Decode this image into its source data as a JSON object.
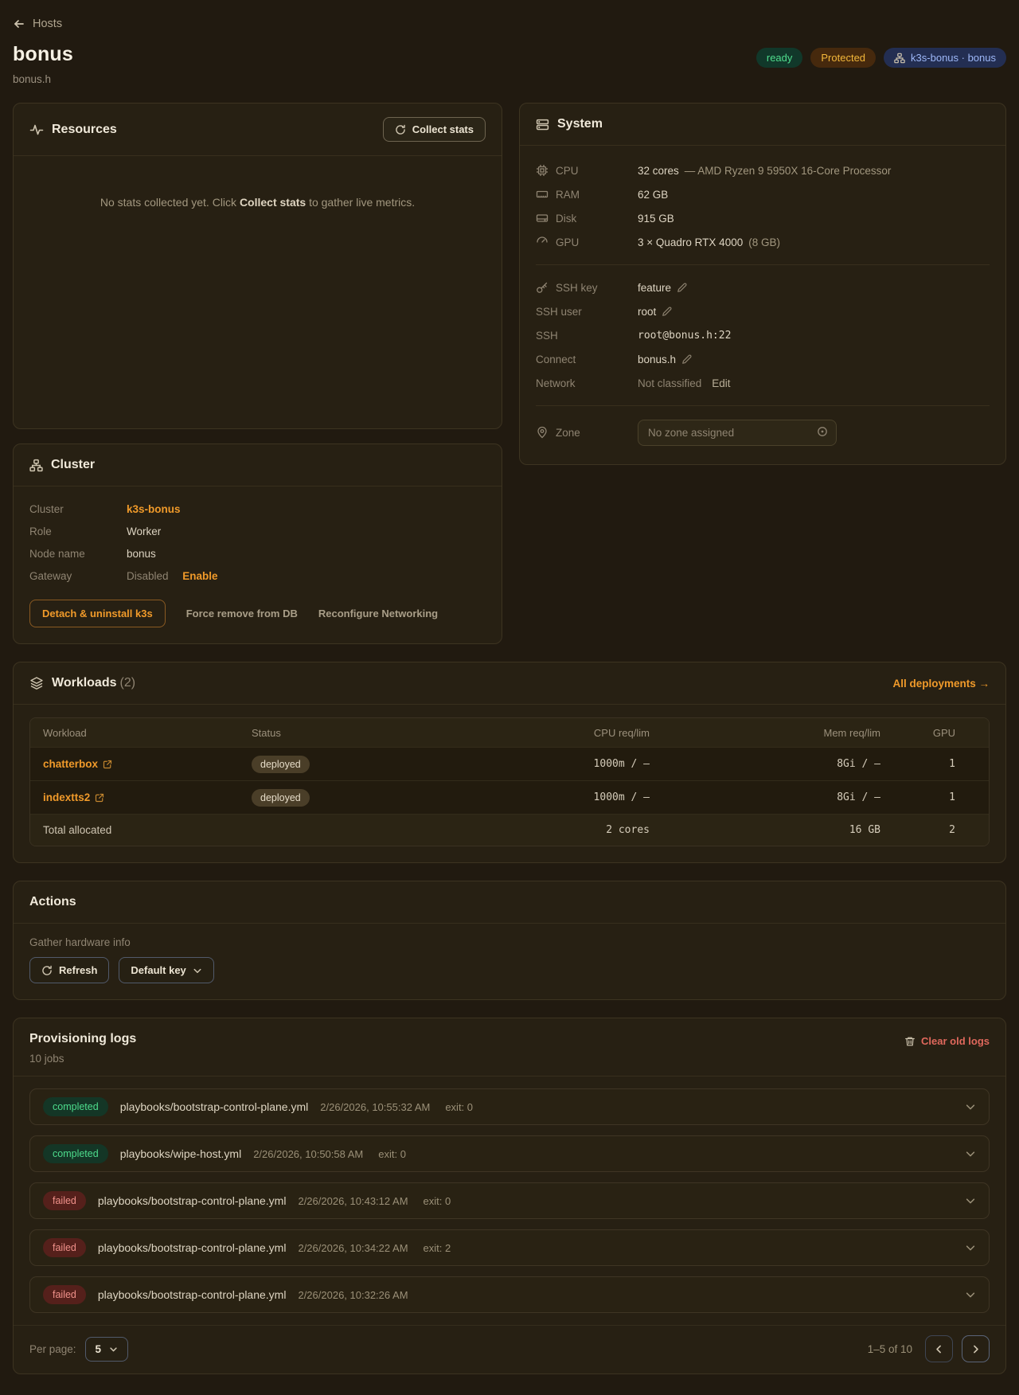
{
  "colors": {
    "accent": "#f09a2a",
    "ready": "#4fdd8d",
    "protected": "#f3b73a",
    "cluster_badge": "#9db7f7",
    "failed": "#f0918a",
    "danger": "#e0685c"
  },
  "header": {
    "back_label": "Hosts",
    "title": "bonus",
    "subtitle": "bonus.h",
    "badge_ready": "ready",
    "badge_protected": "Protected",
    "badge_cluster": "k3s-bonus · bonus"
  },
  "resources": {
    "title": "Resources",
    "collect_button": "Collect stats",
    "empty_pre": "No stats collected yet. Click ",
    "empty_bold": "Collect stats",
    "empty_post": " to gather live metrics."
  },
  "system": {
    "title": "System",
    "cpu_label": "CPU",
    "cpu_value": "32 cores",
    "cpu_detail": "— AMD Ryzen 9 5950X 16-Core Processor",
    "ram_label": "RAM",
    "ram_value": "62 GB",
    "disk_label": "Disk",
    "disk_value": "915 GB",
    "gpu_label": "GPU",
    "gpu_value": "3 × Quadro RTX 4000",
    "gpu_detail": "(8 GB)",
    "ssh_key_label": "SSH key",
    "ssh_key_value": "feature",
    "ssh_user_label": "SSH user",
    "ssh_user_value": "root",
    "ssh_label": "SSH",
    "ssh_value": "root@bonus.h:22",
    "connect_label": "Connect",
    "connect_value": "bonus.h",
    "network_label": "Network",
    "network_value": "Not classified",
    "network_edit": "Edit",
    "zone_label": "Zone",
    "zone_placeholder": "No zone assigned"
  },
  "cluster": {
    "title": "Cluster",
    "cluster_label": "Cluster",
    "cluster_value": "k3s-bonus",
    "role_label": "Role",
    "role_value": "Worker",
    "node_label": "Node name",
    "node_value": "bonus",
    "gateway_label": "Gateway",
    "gateway_value": "Disabled",
    "gateway_action": "Enable",
    "detach_button": "Detach & uninstall k3s",
    "force_remove_button": "Force remove from DB",
    "reconfigure_button": "Reconfigure Networking"
  },
  "workloads": {
    "title": "Workloads",
    "count": "(2)",
    "all_link": "All deployments →",
    "headers": {
      "workload": "Workload",
      "status": "Status",
      "cpu": "CPU req/lim",
      "mem": "Mem req/lim",
      "gpu": "GPU"
    },
    "rows": [
      {
        "name": "chatterbox",
        "status": "deployed",
        "cpu": "1000m / –",
        "mem": "8Gi / –",
        "gpu": "1"
      },
      {
        "name": "indextts2",
        "status": "deployed",
        "cpu": "1000m / –",
        "mem": "8Gi / –",
        "gpu": "1"
      }
    ],
    "total": {
      "label": "Total allocated",
      "cpu": "2 cores",
      "mem": "16 GB",
      "gpu": "2"
    }
  },
  "actions": {
    "title": "Actions",
    "gather_label": "Gather hardware info",
    "refresh_button": "Refresh",
    "key_select": "Default key"
  },
  "logs": {
    "title": "Provisioning logs",
    "subtitle": "10 jobs",
    "clear_button": "Clear old logs",
    "entries": [
      {
        "status": "completed",
        "playbook": "playbooks/bootstrap-control-plane.yml",
        "time": "2/26/2026, 10:55:32 AM",
        "exit": "exit: 0"
      },
      {
        "status": "completed",
        "playbook": "playbooks/wipe-host.yml",
        "time": "2/26/2026, 10:50:58 AM",
        "exit": "exit: 0"
      },
      {
        "status": "failed",
        "playbook": "playbooks/bootstrap-control-plane.yml",
        "time": "2/26/2026, 10:43:12 AM",
        "exit": "exit: 0"
      },
      {
        "status": "failed",
        "playbook": "playbooks/bootstrap-control-plane.yml",
        "time": "2/26/2026, 10:34:22 AM",
        "exit": "exit: 2"
      },
      {
        "status": "failed",
        "playbook": "playbooks/bootstrap-control-plane.yml",
        "time": "2/26/2026, 10:32:26 AM",
        "exit": ""
      }
    ],
    "per_page_label": "Per page:",
    "per_page_value": "5",
    "range": "1–5 of 10"
  }
}
